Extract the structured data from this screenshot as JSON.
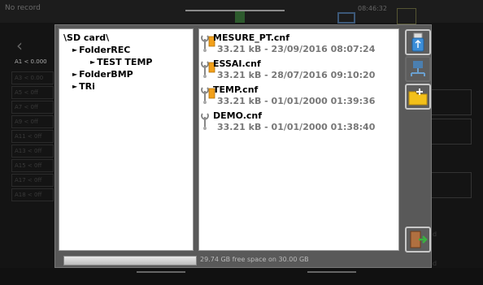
{
  "background": {
    "title": "No record",
    "time": "08:46:32",
    "first_channel": "A1 < 0.000",
    "channels": [
      "A3 < 0.00",
      "A5 < 0ff",
      "A7 < 0ff",
      "A9 < 0ff",
      "A11 < 0ff",
      "A13 < 0ff",
      "A15 < 0ff",
      "A17 < 0ff",
      "A18 < 0ff"
    ],
    "right_labels": [
      "d",
      "d"
    ]
  },
  "dialog": {
    "tree": {
      "root": "\\SD card\\",
      "items": [
        {
          "label": "FolderREC",
          "level": 1
        },
        {
          "label": "TEST TEMP",
          "level": 2
        },
        {
          "label": "FolderBMP",
          "level": 1
        },
        {
          "label": "TRi",
          "level": 1
        }
      ]
    },
    "files": [
      {
        "name": "MESURE_PT.cnf",
        "meta": "33.21 kB - 23/09/2016 08:07:24"
      },
      {
        "name": "ESSAI.cnf",
        "meta": "33.21 kB - 28/07/2016 09:10:20"
      },
      {
        "name": "TEMP.cnf",
        "meta": "33.21 kB - 01/01/2000 01:39:36"
      },
      {
        "name": "DEMO.cnf",
        "meta": "33.21 kB - 01/01/2000 01:38:40"
      }
    ],
    "buttons": {
      "usb": "usb-icon",
      "network": "network-icon",
      "folder": "folder-icon",
      "exit": "exit-door-icon"
    },
    "storage": {
      "used_fraction": 0.02,
      "free_text": "29.74 GB free space on 30.00 GB"
    }
  },
  "colors": {
    "dialog_bg": "#595959",
    "panel_bg": "#ffffff",
    "file_meta": "#777777",
    "icon_orange": "#f2a01a",
    "usb_blue": "#3c8ed8"
  }
}
